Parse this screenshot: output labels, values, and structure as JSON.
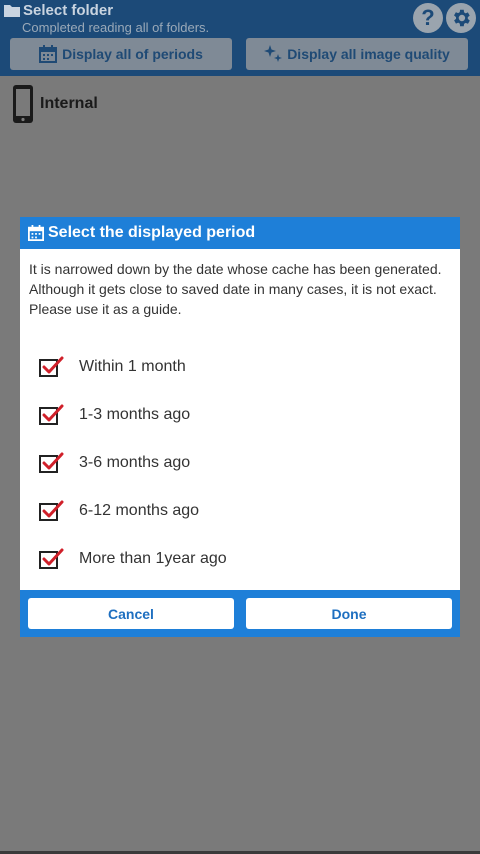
{
  "app": {
    "title": "Select folder",
    "subtitle": "Completed reading all of folders.",
    "help_icon": "help-icon",
    "settings_icon": "gear-icon",
    "filter_period_label": "Display all of periods",
    "filter_quality_label": "Display all image quality",
    "storage_label": "Internal"
  },
  "dialog": {
    "title": "Select the displayed period",
    "description_line1": "It is narrowed down by the date whose cache has been generated.",
    "description_line2": "Although it gets close to saved date in many cases, it is not exact. Please use it as a guide.",
    "options": [
      {
        "label": "Within 1 month",
        "checked": true
      },
      {
        "label": "1-3 months ago",
        "checked": true
      },
      {
        "label": "3-6 months ago",
        "checked": true
      },
      {
        "label": "6-12 months ago",
        "checked": true
      },
      {
        "label": "More than 1year ago",
        "checked": true
      }
    ],
    "cancel_label": "Cancel",
    "done_label": "Done"
  },
  "colors": {
    "header_bg": "#1c4a78",
    "dialog_accent": "#1e7fd8",
    "check_red": "#d0202a"
  }
}
